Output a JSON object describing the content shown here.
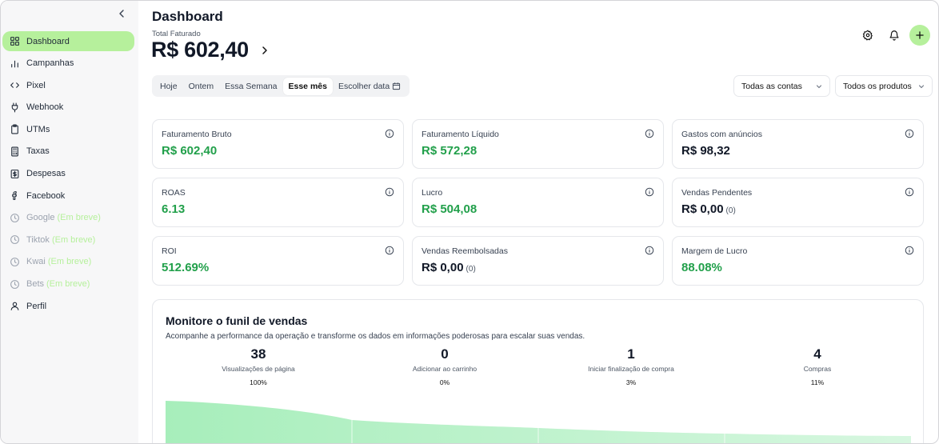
{
  "sidebar": {
    "items": [
      {
        "label": "Dashboard",
        "icon": "grid-icon",
        "active": true
      },
      {
        "label": "Campanhas",
        "icon": "bar-chart-icon"
      },
      {
        "label": "Pixel",
        "icon": "code-icon"
      },
      {
        "label": "Webhook",
        "icon": "plug-icon"
      },
      {
        "label": "UTMs",
        "icon": "clipboard-icon"
      },
      {
        "label": "Taxas",
        "icon": "calculator-icon"
      },
      {
        "label": "Despesas",
        "icon": "receipt-icon"
      },
      {
        "label": "Facebook",
        "icon": "facebook-icon"
      },
      {
        "label": "Google",
        "soon": "(Em breve)",
        "icon": "clock-icon",
        "disabled": true
      },
      {
        "label": "Tiktok",
        "soon": "(Em breve)",
        "icon": "clock-icon",
        "disabled": true
      },
      {
        "label": "Kwai",
        "soon": "(Em breve)",
        "icon": "clock-icon",
        "disabled": true
      },
      {
        "label": "Bets",
        "soon": "(Em breve)",
        "icon": "clock-icon",
        "disabled": true
      },
      {
        "label": "Perfil",
        "icon": "user-icon"
      }
    ]
  },
  "header": {
    "title": "Dashboard",
    "total_label": "Total Faturado",
    "total_value": "R$ 602,40"
  },
  "period_tabs": [
    {
      "label": "Hoje"
    },
    {
      "label": "Ontem"
    },
    {
      "label": "Essa Semana"
    },
    {
      "label": "Esse mês",
      "active": true
    },
    {
      "label": "Escolher data"
    }
  ],
  "filters": {
    "accounts": "Todas as contas",
    "products": "Todos os produtos"
  },
  "cards": [
    {
      "label": "Faturamento Bruto",
      "value": "R$ 602,40",
      "green": true
    },
    {
      "label": "Faturamento Líquido",
      "value": "R$ 572,28",
      "green": true
    },
    {
      "label": "Gastos com anúncios",
      "value": "R$ 98,32",
      "green": false
    },
    {
      "label": "ROAS",
      "value": "6.13",
      "green": true
    },
    {
      "label": "Lucro",
      "value": "R$ 504,08",
      "green": true
    },
    {
      "label": "Vendas Pendentes",
      "value": "R$ 0,00",
      "count": "(0)",
      "green": false
    },
    {
      "label": "ROI",
      "value": "512.69%",
      "green": true
    },
    {
      "label": "Vendas Reembolsadas",
      "value": "R$ 0,00",
      "count": "(0)",
      "green": false
    },
    {
      "label": "Margem de Lucro",
      "value": "88.08%",
      "green": true
    }
  ],
  "funnel": {
    "title": "Monitore o funil de vendas",
    "description": "Acompanhe a performance da operação e transforme os dados em informações poderosas para escalar suas vendas.",
    "stages": [
      {
        "value": "38",
        "label": "Visualizações de página",
        "percent": "100%"
      },
      {
        "value": "0",
        "label": "Adicionar ao carrinho",
        "percent": "0%"
      },
      {
        "value": "1",
        "label": "Iniciar finalização de compra",
        "percent": "3%"
      },
      {
        "value": "4",
        "label": "Compras",
        "percent": "11%"
      }
    ]
  },
  "colors": {
    "accent": "#b6f09c",
    "positive": "#22a04b"
  }
}
